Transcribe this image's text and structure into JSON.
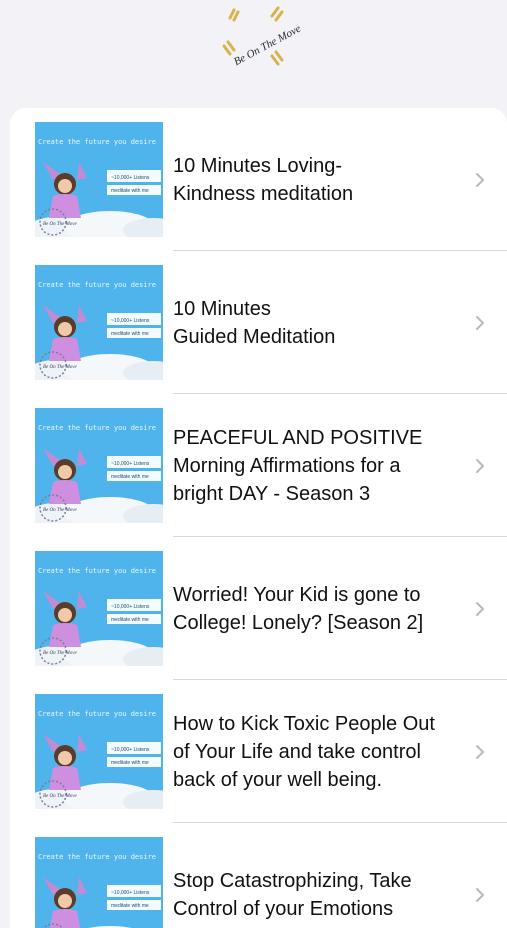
{
  "logo": {
    "text": "Be On The Move"
  },
  "thumbnail": {
    "caption": "Create the future you desire",
    "badge_line1": "~10,000+ Listens",
    "badge_line2": "meditate with me",
    "stamp_text": "Be On The Move"
  },
  "episodes": [
    {
      "title": "10 Minutes Loving-\nKindness meditation"
    },
    {
      "title": "10 Minutes\nGuided Meditation"
    },
    {
      "title": "PEACEFUL AND POSITIVE\nMorning Affirmations for a\nbright  DAY -  Season 3"
    },
    {
      "title": "Worried! Your Kid is gone to\nCollege! Lonely? [Season 2]"
    },
    {
      "title": "How to Kick Toxic People Out\nof Your Life and take control\nback of your well being."
    },
    {
      "title": "Stop Catastrophizing, Take\nControl of your Emotions"
    }
  ],
  "colors": {
    "background": "#f2f2f7",
    "card": "#ffffff",
    "thumb_sky": "#4fb3ec",
    "chevron": "#b8b8be"
  }
}
